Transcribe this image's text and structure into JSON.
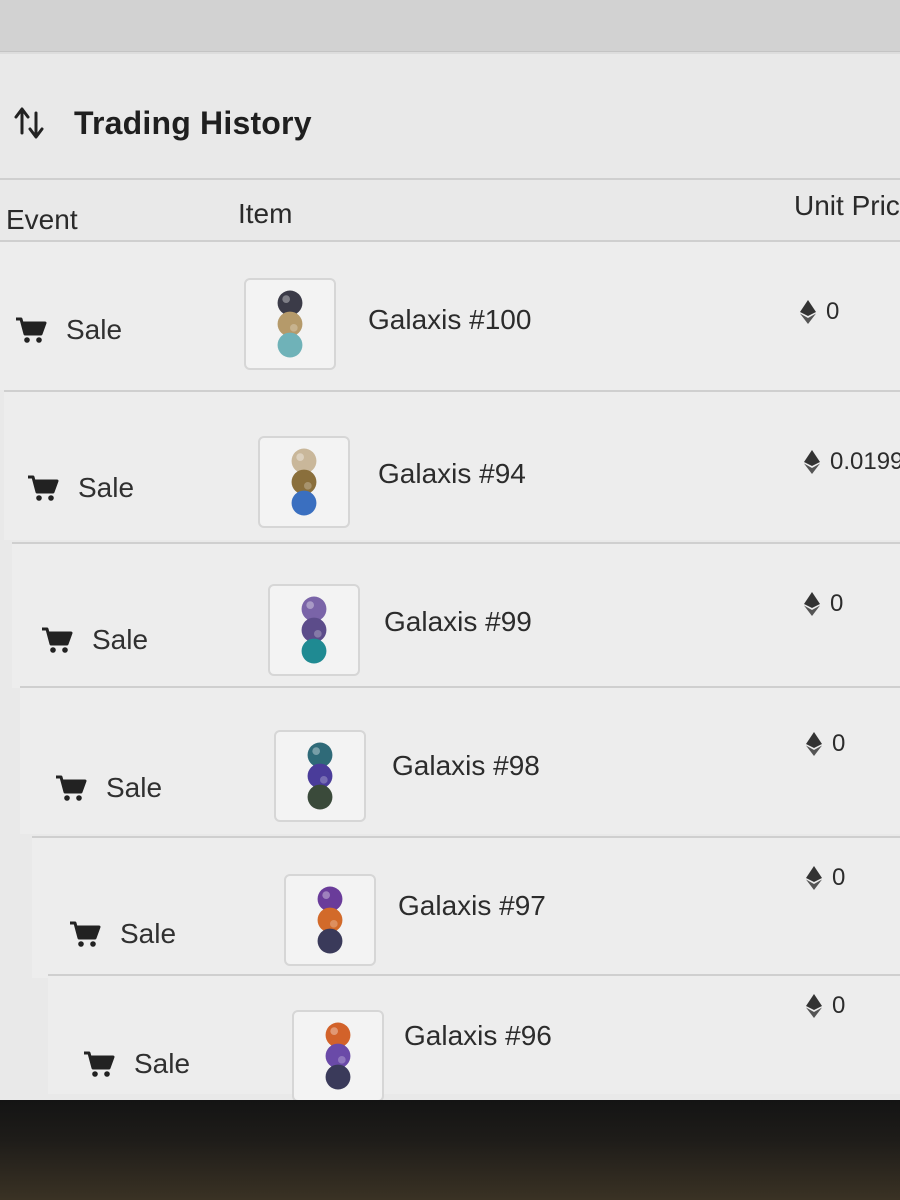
{
  "section": {
    "title": "Trading History",
    "icon": "sort-arrows-icon"
  },
  "table": {
    "columns": [
      "Event",
      "Item",
      "Unit Pric"
    ],
    "rows": [
      {
        "event": "Sale",
        "event_icon": "cart-icon",
        "item": "Galaxis #100",
        "price": "0",
        "price_icon": "eth-icon",
        "colors": [
          "#3b3b48",
          "#b59a6a",
          "#6fb2b8"
        ]
      },
      {
        "event": "Sale",
        "event_icon": "cart-icon",
        "item": "Galaxis #94",
        "price": "0.0199",
        "price_icon": "eth-icon",
        "colors": [
          "#c9b79a",
          "#8a6f3c",
          "#3a6fc0"
        ]
      },
      {
        "event": "Sale",
        "event_icon": "cart-icon",
        "item": "Galaxis #99",
        "price": "0",
        "price_icon": "eth-icon",
        "colors": [
          "#7a64a8",
          "#5c4c8a",
          "#1f8a92"
        ]
      },
      {
        "event": "Sale",
        "event_icon": "cart-icon",
        "item": "Galaxis #98",
        "price": "0",
        "price_icon": "eth-icon",
        "colors": [
          "#2f6a78",
          "#4a3c9a",
          "#3a4a3a"
        ]
      },
      {
        "event": "Sale",
        "event_icon": "cart-icon",
        "item": "Galaxis #97",
        "price": "0",
        "price_icon": "eth-icon",
        "colors": [
          "#6a3c9a",
          "#d26a2a",
          "#3a3a5a"
        ]
      },
      {
        "event": "Sale",
        "event_icon": "cart-icon",
        "item": "Galaxis #96",
        "price": "0",
        "price_icon": "eth-icon",
        "colors": [
          "#d2622a",
          "#6a4aa8",
          "#3a3a5a"
        ]
      }
    ]
  }
}
